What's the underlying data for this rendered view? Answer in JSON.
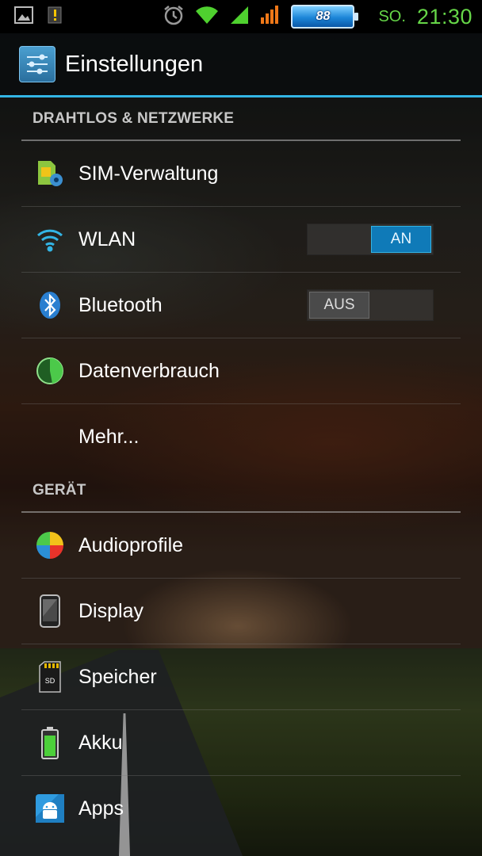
{
  "status_bar": {
    "day": "SO.",
    "time": "21:30",
    "battery_level": "88",
    "icons": [
      "picture-icon",
      "notification-alert-icon",
      "alarm-clock-icon",
      "wifi-signal-icon",
      "cell-signal-green-icon",
      "cell-signal-orange-icon",
      "battery-icon"
    ]
  },
  "action_bar": {
    "title": "Einstellungen",
    "icon": "settings-sliders-icon"
  },
  "sections": {
    "wireless": {
      "header": "DRAHTLOS & NETZWERKE",
      "items": [
        {
          "label": "SIM-Verwaltung",
          "icon": "sim-card-gear-icon"
        },
        {
          "label": "WLAN",
          "icon": "wifi-icon",
          "toggle": "AN",
          "enabled": true
        },
        {
          "label": "Bluetooth",
          "icon": "bluetooth-icon",
          "toggle": "AUS",
          "enabled": false
        },
        {
          "label": "Datenverbrauch",
          "icon": "data-usage-icon"
        },
        {
          "label": "Mehr..."
        }
      ]
    },
    "device": {
      "header": "GERÄT",
      "items": [
        {
          "label": "Audioprofile",
          "icon": "audio-profiles-icon"
        },
        {
          "label": "Display",
          "icon": "phone-display-icon"
        },
        {
          "label": "Speicher",
          "icon": "sd-card-icon"
        },
        {
          "label": "Akku",
          "icon": "battery-green-icon"
        },
        {
          "label": "Apps",
          "icon": "android-apps-icon"
        }
      ]
    }
  },
  "colors": {
    "accent": "#33b5e5",
    "clock": "#66d648",
    "toggle_on": "#0f7ab8"
  }
}
